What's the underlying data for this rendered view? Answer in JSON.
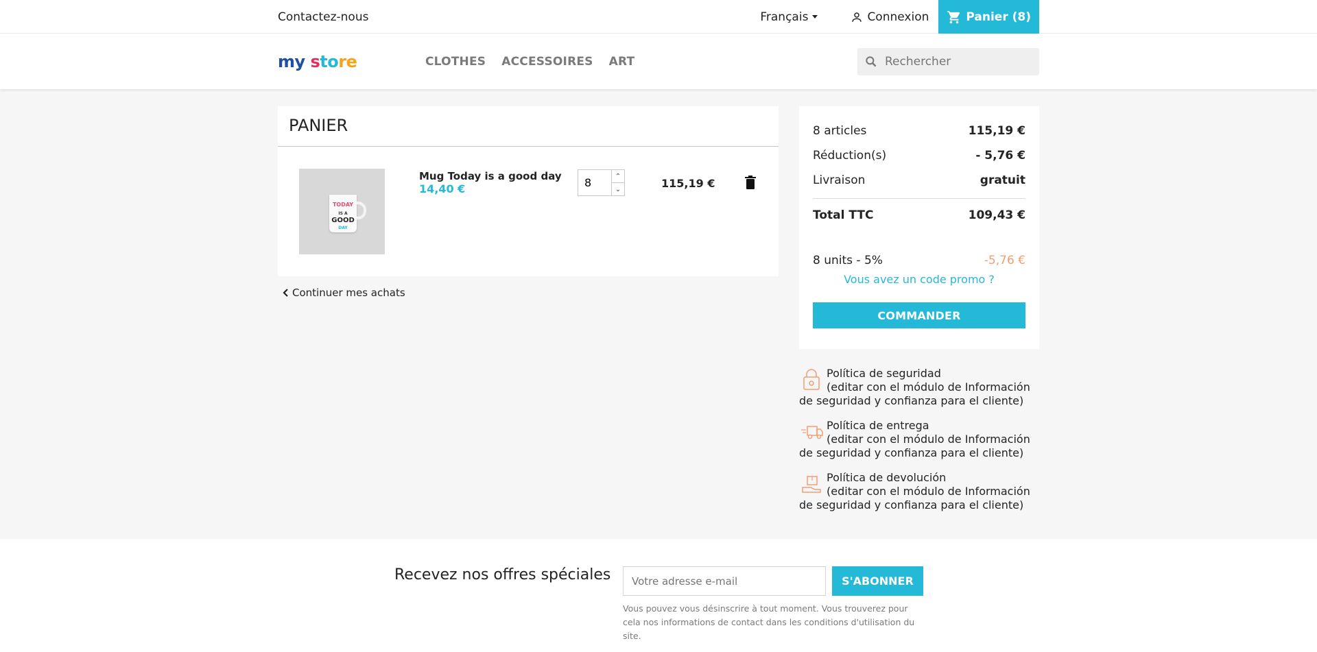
{
  "topbar": {
    "contact": "Contactez-nous",
    "language": "Français",
    "signin": "Connexion",
    "cart": "Panier (8)"
  },
  "header": {
    "logo": {
      "a": "my",
      "b": " s",
      "c": "to",
      "d": "re"
    },
    "menu": [
      "CLOTHES",
      "ACCESSOIRES",
      "ART"
    ],
    "search_placeholder": "Rechercher"
  },
  "cart": {
    "title": "PANIER",
    "item": {
      "image_text": [
        "TODAY",
        "IS A",
        "GOOD",
        "DAY"
      ],
      "name": "Mug Today is a good day",
      "unit_price": "14,40 €",
      "quantity": "8",
      "total": "115,19 €"
    },
    "continue": "Continuer mes achats"
  },
  "summary": {
    "articles_label": "8 articles",
    "articles_value": "115,19 €",
    "reduction_label": "Réduction(s)",
    "reduction_value": "- 5,76 €",
    "shipping_label": "Livraison",
    "shipping_value": "gratuit",
    "total_label": "Total TTC",
    "total_value": "109,43 €",
    "discount_label": "8 units - 5%",
    "discount_value": "-5,76 €",
    "promo": "Vous avez un code promo ?",
    "order_button": "COMMANDER"
  },
  "reassurance": [
    {
      "title": "Política de seguridad",
      "desc": "(editar con el módulo de Información de seguridad y confianza para el cliente)",
      "icon": "lock-icon"
    },
    {
      "title": "Política de entrega",
      "desc": "(editar con el módulo de Información de seguridad y confianza para el cliente)",
      "icon": "truck-icon"
    },
    {
      "title": "Política de devolución",
      "desc": "(editar con el módulo de Información de seguridad y confianza para el cliente)",
      "icon": "return-icon"
    }
  ],
  "footer": {
    "newsletter_title": "Recevez nos offres spéciales",
    "email_placeholder": "Votre adresse e-mail",
    "subscribe": "S'ABONNER",
    "legal": "Vous pouvez vous désinscrire à tout moment. Vous trouverez pour cela nos informations de contact dans les conditions d'utilisation du site."
  },
  "colors": {
    "accent": "#24b9d7",
    "discount": "#f39d72",
    "reassurance_icon": "#f39d72"
  }
}
